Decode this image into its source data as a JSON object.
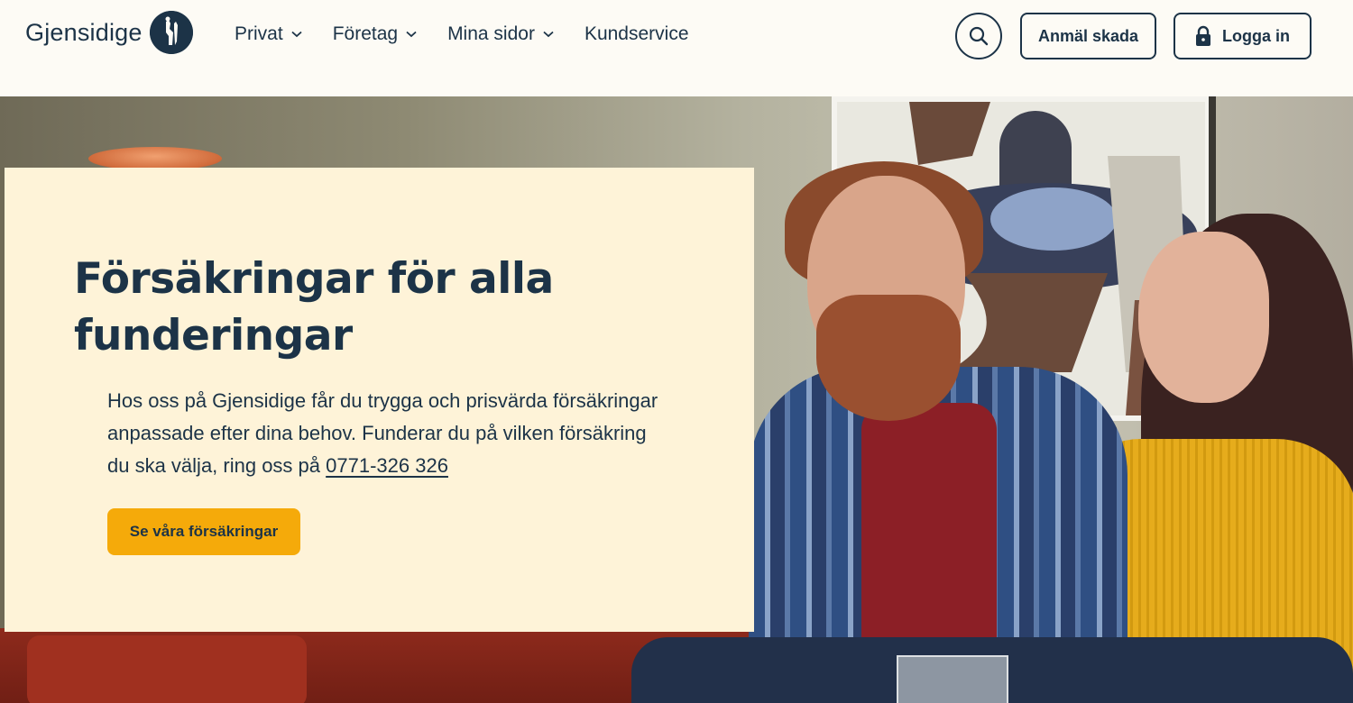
{
  "header": {
    "logo_text": "Gjensidige",
    "nav": [
      {
        "label": "Privat",
        "has_dropdown": true
      },
      {
        "label": "Företag",
        "has_dropdown": true
      },
      {
        "label": "Mina sidor",
        "has_dropdown": true
      },
      {
        "label": "Kundservice",
        "has_dropdown": false
      }
    ],
    "search_icon": "search-icon",
    "claim_button": "Anmäl skada",
    "login_button": "Logga in",
    "login_icon": "lock-icon"
  },
  "hero": {
    "title": "Försäkringar för alla funderingar",
    "text": "Hos oss på Gjensidige får du trygga och prisvärda försäkringar anpassade efter dina behov. Funderar du på vilken försäkring du ska välja, ring oss på",
    "phone": "0771-326 326",
    "cta": "Se våra försäkringar"
  },
  "colors": {
    "brand_navy": "#1c3347",
    "card_bg": "#fef3d8",
    "cta_yellow": "#f5aa0a",
    "page_bg": "#fdfbf5"
  }
}
